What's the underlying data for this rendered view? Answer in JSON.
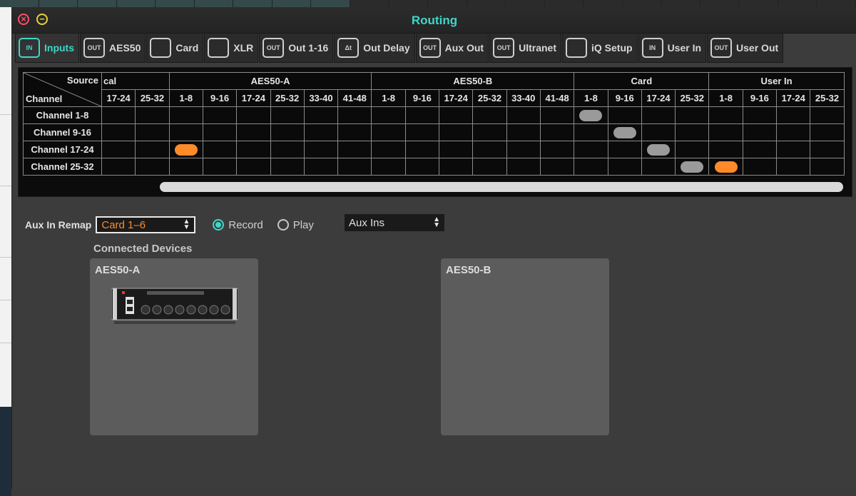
{
  "window": {
    "title": "Routing",
    "close_glyph": "×",
    "minimize_glyph": "−"
  },
  "tabs": [
    {
      "label": "Inputs",
      "icon": "in-port-icon",
      "icon_text": "IN",
      "active": true
    },
    {
      "label": "AES50",
      "icon": "out-port-icon",
      "icon_text": "OUT",
      "active": false
    },
    {
      "label": "Card",
      "icon": "card-icon",
      "icon_text": "",
      "active": false
    },
    {
      "label": "XLR",
      "icon": "xlr-icon",
      "icon_text": "",
      "active": false
    },
    {
      "label": "Out 1-16",
      "icon": "out-port-icon",
      "icon_text": "OUT",
      "active": false
    },
    {
      "label": "Out Delay",
      "icon": "delay-icon",
      "icon_text": "Δt",
      "active": false
    },
    {
      "label": "Aux Out",
      "icon": "out-port-icon",
      "icon_text": "OUT",
      "active": false
    },
    {
      "label": "Ultranet",
      "icon": "out-port-icon",
      "icon_text": "OUT",
      "active": false
    },
    {
      "label": "iQ Setup",
      "icon": "speaker-icon",
      "icon_text": "",
      "active": false
    },
    {
      "label": "User In",
      "icon": "in-port-icon",
      "icon_text": "IN",
      "active": false
    },
    {
      "label": "User Out",
      "icon": "out-port-icon",
      "icon_text": "OUT",
      "active": false
    }
  ],
  "grid": {
    "corner_source": "Source",
    "corner_channel": "Channel",
    "groups": [
      {
        "label": "cal",
        "span": 2
      },
      {
        "label": "AES50-A",
        "span": 6
      },
      {
        "label": "AES50-B",
        "span": 6
      },
      {
        "label": "Card",
        "span": 4
      },
      {
        "label": "User In",
        "span": 4
      }
    ],
    "columns": [
      "17-24",
      "25-32",
      "1-8",
      "9-16",
      "17-24",
      "25-32",
      "33-40",
      "41-48",
      "1-8",
      "9-16",
      "17-24",
      "25-32",
      "33-40",
      "41-48",
      "1-8",
      "9-16",
      "17-24",
      "25-32",
      "1-8",
      "9-16",
      "17-24",
      "25-32"
    ],
    "rows": [
      "Channel 1-8",
      "Channel 9-16",
      "Channel 17-24",
      "Channel 25-32"
    ],
    "patches": [
      {
        "row": 0,
        "col": 14,
        "color": "gray"
      },
      {
        "row": 1,
        "col": 15,
        "color": "gray"
      },
      {
        "row": 2,
        "col": 2,
        "color": "orange"
      },
      {
        "row": 2,
        "col": 16,
        "color": "gray"
      },
      {
        "row": 3,
        "col": 17,
        "color": "gray"
      },
      {
        "row": 3,
        "col": 18,
        "color": "orange"
      }
    ]
  },
  "aux_remap": {
    "label": "Aux In Remap",
    "value": "Card 1–6",
    "record_label": "Record",
    "play_label": "Play",
    "selected_mode": "Record",
    "aux_select_value": "Aux Ins"
  },
  "connected": {
    "title": "Connected Devices",
    "devices": [
      {
        "name": "AES50-A",
        "has_device": true
      },
      {
        "name": "AES50-B",
        "has_device": false
      }
    ]
  },
  "colors": {
    "accent": "#3fd6c8",
    "patch_orange": "#ff8a2a",
    "patch_gray": "#9a9a9a"
  }
}
